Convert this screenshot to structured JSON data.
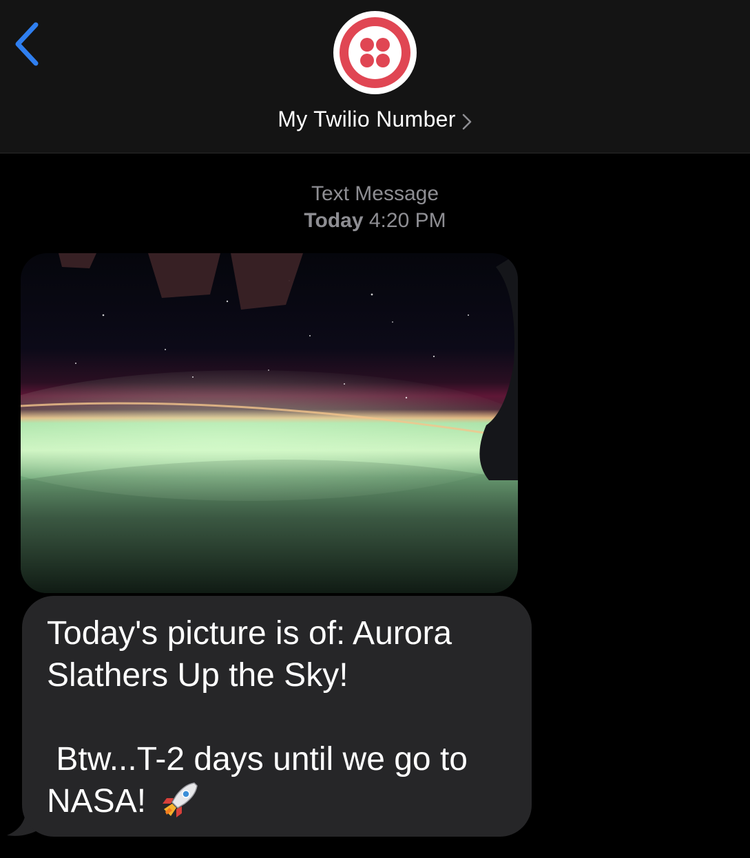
{
  "header": {
    "contact_name": "My Twilio Number",
    "back_icon": "chevron-left-icon",
    "avatar_icon": "twilio-logo-icon",
    "contact_chevron_icon": "chevron-right-icon",
    "accent_color": "#2f7ff0",
    "logo_color": "#e04653"
  },
  "conversation": {
    "service_label": "Text Message",
    "day_label": "Today",
    "time_label": "4:20 PM",
    "messages": [
      {
        "type": "image",
        "alt_icon": "aurora-photo"
      },
      {
        "type": "text",
        "text": "Today's picture is of: Aurora Slathers Up the Sky!\n\n Btw...T-2 days until we go to NASA! ",
        "emoji_icon": "rocket-icon"
      }
    ]
  }
}
